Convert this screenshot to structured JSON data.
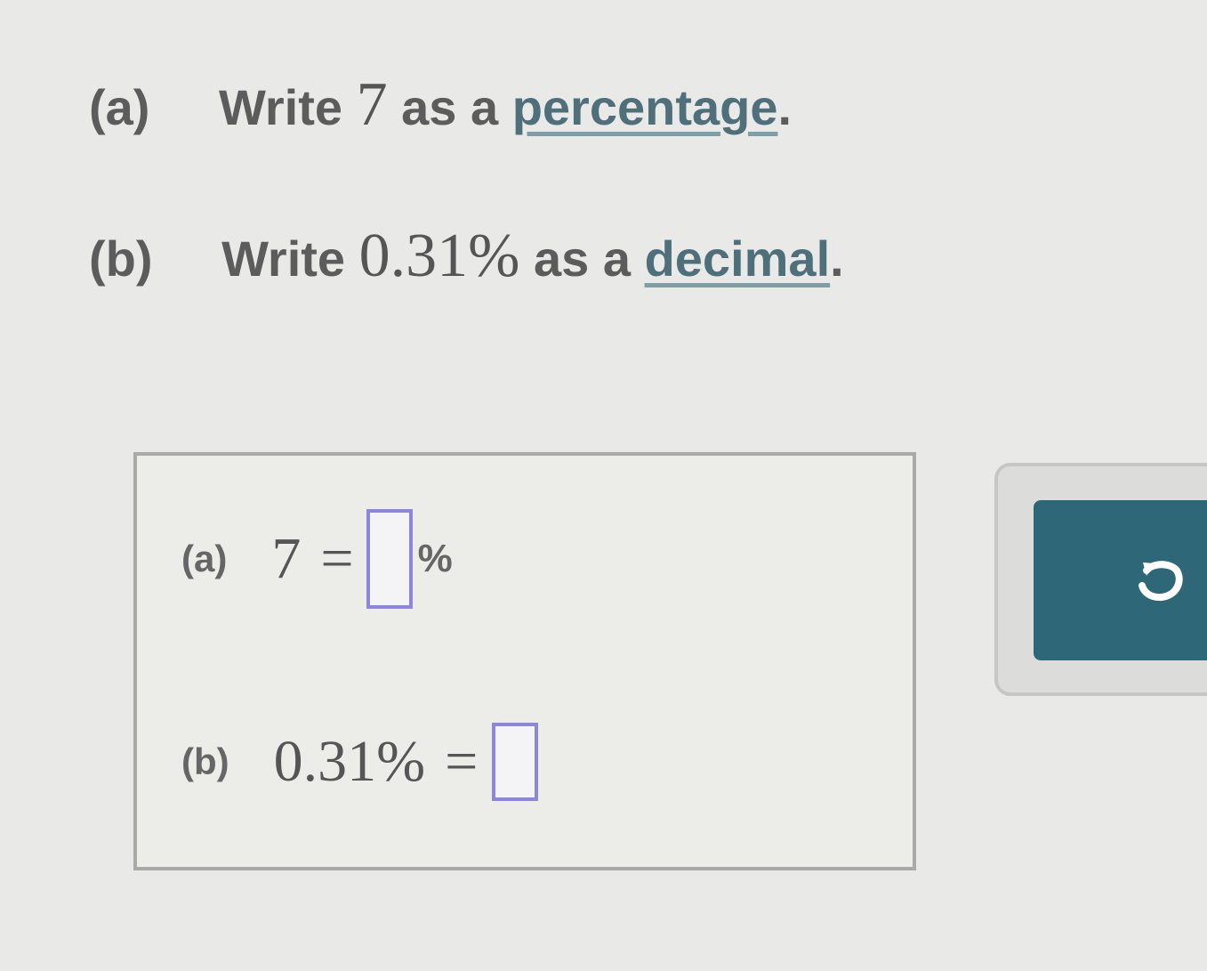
{
  "questions": {
    "a": {
      "label": "(a)",
      "prefix": "Write",
      "value": "7",
      "middle": "as a",
      "term": "percentage",
      "suffix": "."
    },
    "b": {
      "label": "(b)",
      "prefix": "Write",
      "value": "0.31%",
      "middle": "as a",
      "term": "decimal",
      "suffix": "."
    }
  },
  "answers": {
    "a": {
      "label": "(a)",
      "left": "7",
      "equals": "=",
      "input_value": "",
      "unit": "%"
    },
    "b": {
      "label": "(b)",
      "left": "0.31%",
      "equals": "=",
      "input_value": ""
    }
  },
  "tools": {
    "undo_icon": "undo-icon"
  },
  "colors": {
    "accent": "#2e6777",
    "input_border": "#8e86dc",
    "link": "#4f6f7a"
  }
}
